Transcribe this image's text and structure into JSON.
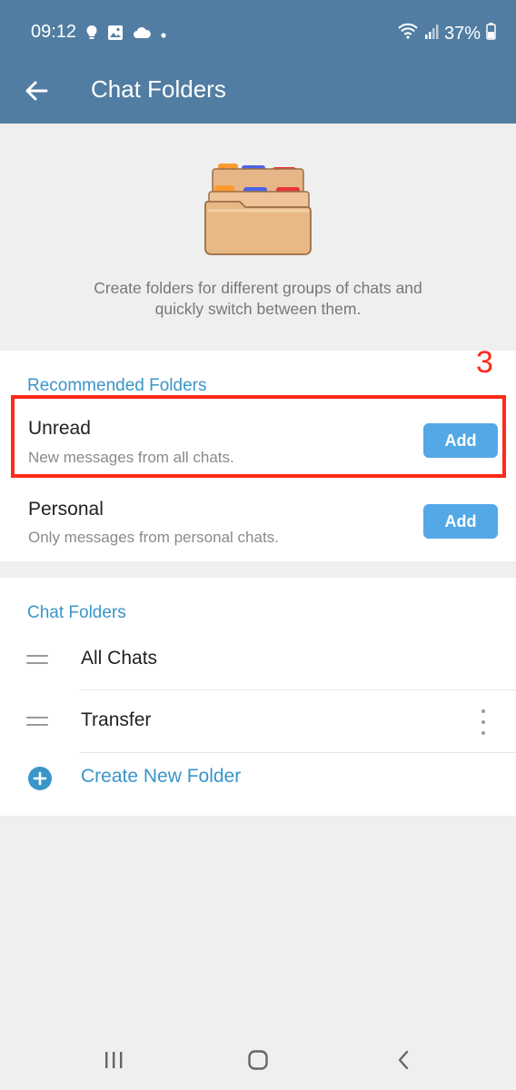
{
  "status_bar": {
    "time": "09:12",
    "battery": "37%",
    "icons_left": [
      "lightbulb-icon",
      "image-icon",
      "cloud-icon",
      "dot-icon"
    ],
    "icons_right": [
      "wifi-icon",
      "signal-icon",
      "battery-icon"
    ]
  },
  "app_bar": {
    "title": "Chat Folders",
    "back_icon": "arrow-left-icon"
  },
  "header": {
    "illustration": "folders-icon",
    "description_line1": "Create folders for different groups of chats and",
    "description_line2": "quickly switch between them."
  },
  "recommended": {
    "title": "Recommended Folders",
    "items": [
      {
        "title": "Unread",
        "subtitle": "New messages from all chats.",
        "button": "Add"
      },
      {
        "title": "Personal",
        "subtitle": "Only messages from personal chats.",
        "button": "Add"
      }
    ]
  },
  "annotation": {
    "number": "3",
    "color": "#ff2a1a"
  },
  "chat_folders": {
    "title": "Chat Folders",
    "items": [
      {
        "name": "All Chats"
      },
      {
        "name": "Transfer"
      }
    ],
    "create_label": "Create New Folder"
  },
  "colors": {
    "header_bar": "#517da2",
    "accent": "#3a95c9",
    "add_button": "#55a8e6",
    "background": "#efefef"
  },
  "nav_bar": {
    "icons": [
      "recent-apps-icon",
      "home-icon",
      "back-icon"
    ]
  }
}
